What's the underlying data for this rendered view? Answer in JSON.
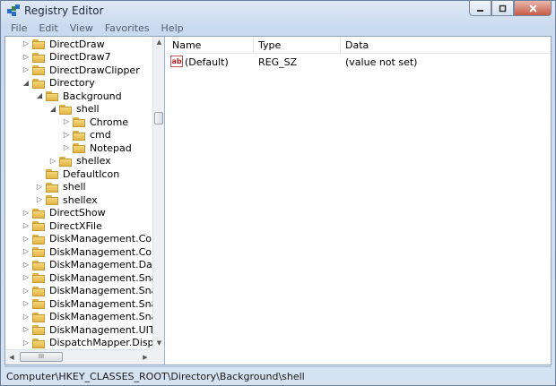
{
  "window": {
    "title": "Registry Editor"
  },
  "menu": [
    "File",
    "Edit",
    "View",
    "Favorites",
    "Help"
  ],
  "tree": [
    {
      "label": "DirectDraw",
      "indent": 0,
      "arrow": "▷"
    },
    {
      "label": "DirectDraw7",
      "indent": 0,
      "arrow": "▷"
    },
    {
      "label": "DirectDrawClipper",
      "indent": 0,
      "arrow": "▷"
    },
    {
      "label": "Directory",
      "indent": 0,
      "arrow": "◢"
    },
    {
      "label": "Background",
      "indent": 1,
      "arrow": "◢"
    },
    {
      "label": "shell",
      "indent": 2,
      "arrow": "◢"
    },
    {
      "label": "Chrome",
      "indent": 3,
      "arrow": "▷"
    },
    {
      "label": "cmd",
      "indent": 3,
      "arrow": "▷"
    },
    {
      "label": "Notepad",
      "indent": 3,
      "arrow": "▷"
    },
    {
      "label": "shellex",
      "indent": 2,
      "arrow": "▷"
    },
    {
      "label": "DefaultIcon",
      "indent": 1,
      "arrow": ""
    },
    {
      "label": "shell",
      "indent": 1,
      "arrow": "▷"
    },
    {
      "label": "shellex",
      "indent": 1,
      "arrow": "▷"
    },
    {
      "label": "DirectShow",
      "indent": 0,
      "arrow": "▷"
    },
    {
      "label": "DirectXFile",
      "indent": 0,
      "arrow": "▷"
    },
    {
      "label": "DiskManagement.Connect",
      "indent": 0,
      "arrow": "▷"
    },
    {
      "label": "DiskManagement.Control",
      "indent": 0,
      "arrow": "▷"
    },
    {
      "label": "DiskManagement.DataObj",
      "indent": 0,
      "arrow": "▷"
    },
    {
      "label": "DiskManagement.SnapIn",
      "indent": 0,
      "arrow": "▷"
    },
    {
      "label": "DiskManagement.SnapInA",
      "indent": 0,
      "arrow": "▷"
    },
    {
      "label": "DiskManagement.SnapInC",
      "indent": 0,
      "arrow": "▷"
    },
    {
      "label": "DiskManagement.SnapInE",
      "indent": 0,
      "arrow": "▷"
    },
    {
      "label": "DiskManagement.UITasks",
      "indent": 0,
      "arrow": "▷"
    },
    {
      "label": "DispatchMapper.Dispatch",
      "indent": 0,
      "arrow": "▷"
    }
  ],
  "list": {
    "columns": [
      "Name",
      "Type",
      "Data"
    ],
    "rows": [
      {
        "name": "(Default)",
        "type": "REG_SZ",
        "data": "(value not set)"
      }
    ]
  },
  "hscroll_thumb": "III",
  "status": "Computer\\HKEY_CLASSES_ROOT\\Directory\\Background\\shell"
}
